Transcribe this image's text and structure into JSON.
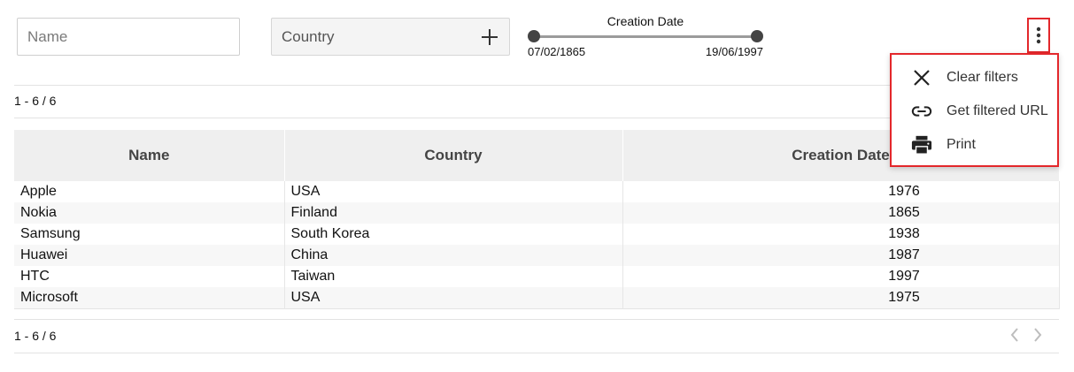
{
  "filters": {
    "name_placeholder": "Name",
    "country_label": "Country",
    "creation_date": {
      "title": "Creation Date",
      "min_label": "07/02/1865",
      "max_label": "19/06/1997"
    }
  },
  "pagination": {
    "top_count": "1 - 6 / 6",
    "bottom_count": "1 - 6 / 6"
  },
  "table": {
    "columns": [
      "Name",
      "Country",
      "Creation Date"
    ],
    "rows": [
      {
        "name": "Apple",
        "country": "USA",
        "year": "1976"
      },
      {
        "name": "Nokia",
        "country": "Finland",
        "year": "1865"
      },
      {
        "name": "Samsung",
        "country": "South Korea",
        "year": "1938"
      },
      {
        "name": "Huawei",
        "country": "China",
        "year": "1987"
      },
      {
        "name": "HTC",
        "country": "Taiwan",
        "year": "1997"
      },
      {
        "name": "Microsoft",
        "country": "USA",
        "year": "1975"
      }
    ]
  },
  "menu": {
    "items": [
      {
        "label": "Clear filters",
        "icon": "close-icon"
      },
      {
        "label": "Get filtered URL",
        "icon": "link-icon"
      },
      {
        "label": "Print",
        "icon": "print-icon"
      }
    ]
  },
  "colors": {
    "highlight": "#e3272b",
    "header_bg": "#efefef",
    "zebra": "#f7f7f7"
  }
}
